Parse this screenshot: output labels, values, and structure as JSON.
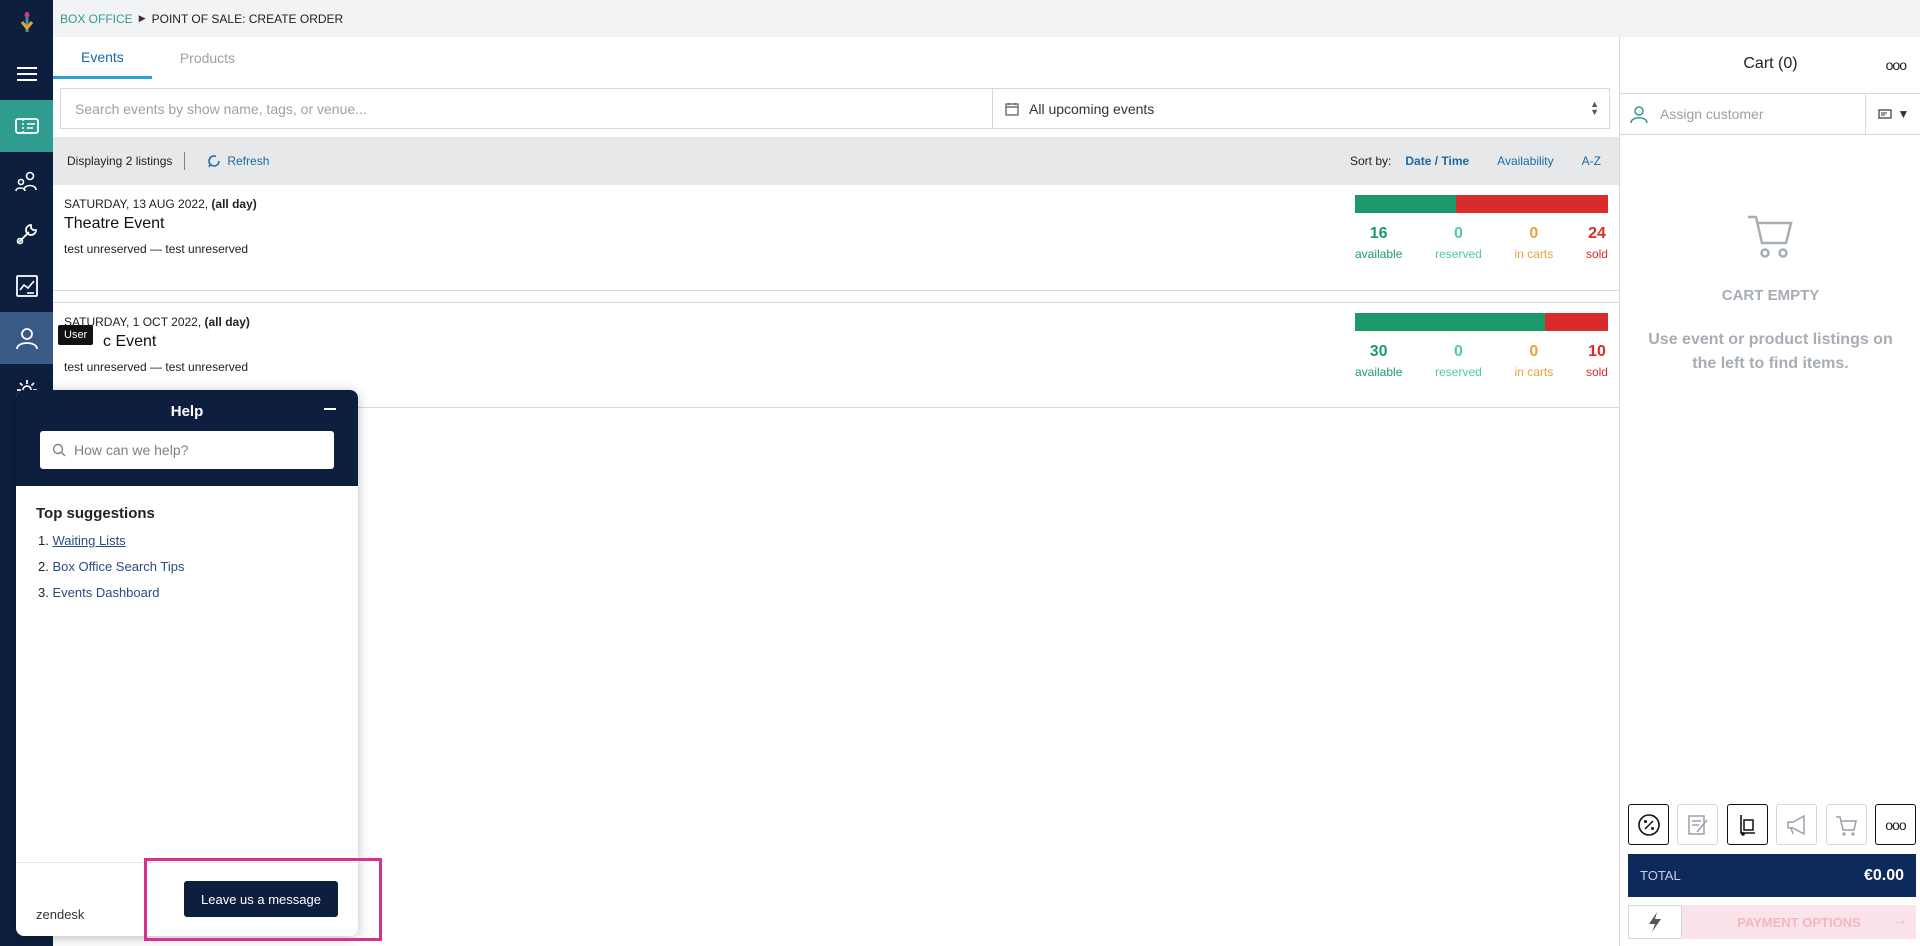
{
  "breadcrumb": {
    "section": "BOX OFFICE",
    "separator": "▶",
    "page": "POINT OF SALE: CREATE ORDER"
  },
  "tabs": [
    {
      "label": "Events",
      "active": true
    },
    {
      "label": "Products",
      "active": false
    }
  ],
  "search": {
    "placeholder": "Search events by show name, tags, or venue...",
    "value": ""
  },
  "date_filter": {
    "value": "All upcoming events"
  },
  "listing_bar": {
    "count": "Displaying 2 listings",
    "refresh": "Refresh",
    "sort_label": "Sort by:",
    "sort_options": [
      "Date / Time",
      "Availability",
      "A-Z"
    ],
    "sort_active": "Date / Time"
  },
  "events": [
    {
      "date": "SATURDAY, 13 AUG 2022,",
      "date_suffix": "(all day)",
      "title": "Theatre Event",
      "venue": "test unreserved — test unreserved",
      "available_fraction": 0.4,
      "stats": {
        "available": "16",
        "reserved": "0",
        "in_carts": "0",
        "sold": "24"
      }
    },
    {
      "date": "SATURDAY, 1 OCT 2022,",
      "date_suffix": "(all day)",
      "title": "c Event",
      "venue": "test unreserved — test unreserved",
      "available_fraction": 0.75,
      "stats": {
        "available": "30",
        "reserved": "0",
        "in_carts": "0",
        "sold": "10"
      }
    }
  ],
  "stat_labels": {
    "available": "available",
    "reserved": "reserved",
    "in_carts": "in carts",
    "sold": "sold"
  },
  "cart": {
    "title": "Cart (0)",
    "menu": "ooo",
    "assign_customer": "Assign customer",
    "empty_title": "CART EMPTY",
    "empty_desc": "Use event or product listings on the left to find items.",
    "total_label": "TOTAL",
    "total_value": "€0.00",
    "payment_label": "PAYMENT OPTIONS",
    "tools_more": "ooo"
  },
  "tooltip": {
    "text": "User"
  },
  "help": {
    "title": "Help",
    "search_placeholder": "How can we help?",
    "suggestions_title": "Top suggestions",
    "suggestions": [
      "1.",
      "Waiting Lists",
      "2.",
      "Box Office Search Tips",
      "3.",
      "Events Dashboard"
    ],
    "brand": "zendesk",
    "leave_message": "Leave us a message"
  },
  "colors": {
    "nav_bg": "#0d1e3f",
    "accent": "#2e9c8e",
    "available": "#1d9a6c",
    "sold": "#d92b2b",
    "highlight": "#d6318f"
  }
}
